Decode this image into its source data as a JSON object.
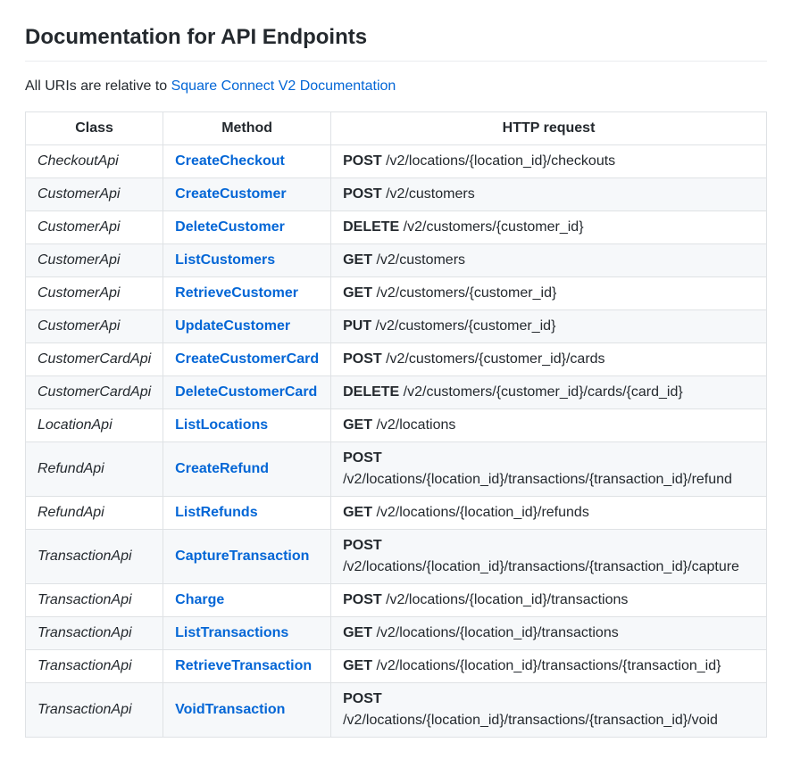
{
  "heading": "Documentation for API Endpoints",
  "intro_prefix": "All URIs are relative to ",
  "intro_link": "Square Connect V2 Documentation",
  "table": {
    "headers": {
      "class": "Class",
      "method": "Method",
      "request": "HTTP request"
    },
    "rows": [
      {
        "class": "CheckoutApi",
        "method": "CreateCheckout",
        "verb": "POST",
        "path": "/v2/locations/{location_id}/checkouts"
      },
      {
        "class": "CustomerApi",
        "method": "CreateCustomer",
        "verb": "POST",
        "path": "/v2/customers"
      },
      {
        "class": "CustomerApi",
        "method": "DeleteCustomer",
        "verb": "DELETE",
        "path": "/v2/customers/{customer_id}"
      },
      {
        "class": "CustomerApi",
        "method": "ListCustomers",
        "verb": "GET",
        "path": "/v2/customers"
      },
      {
        "class": "CustomerApi",
        "method": "RetrieveCustomer",
        "verb": "GET",
        "path": "/v2/customers/{customer_id}"
      },
      {
        "class": "CustomerApi",
        "method": "UpdateCustomer",
        "verb": "PUT",
        "path": "/v2/customers/{customer_id}"
      },
      {
        "class": "CustomerCardApi",
        "method": "CreateCustomerCard",
        "verb": "POST",
        "path": "/v2/customers/{customer_id}/cards"
      },
      {
        "class": "CustomerCardApi",
        "method": "DeleteCustomerCard",
        "verb": "DELETE",
        "path": "/v2/customers/{customer_id}/cards/{card_id}"
      },
      {
        "class": "LocationApi",
        "method": "ListLocations",
        "verb": "GET",
        "path": "/v2/locations"
      },
      {
        "class": "RefundApi",
        "method": "CreateRefund",
        "verb": "POST",
        "path": "/v2/locations/{location_id}/transactions/{transaction_id}/refund"
      },
      {
        "class": "RefundApi",
        "method": "ListRefunds",
        "verb": "GET",
        "path": "/v2/locations/{location_id}/refunds"
      },
      {
        "class": "TransactionApi",
        "method": "CaptureTransaction",
        "verb": "POST",
        "path": "/v2/locations/{location_id}/transactions/{transaction_id}/capture"
      },
      {
        "class": "TransactionApi",
        "method": "Charge",
        "verb": "POST",
        "path": "/v2/locations/{location_id}/transactions"
      },
      {
        "class": "TransactionApi",
        "method": "ListTransactions",
        "verb": "GET",
        "path": "/v2/locations/{location_id}/transactions"
      },
      {
        "class": "TransactionApi",
        "method": "RetrieveTransaction",
        "verb": "GET",
        "path": "/v2/locations/{location_id}/transactions/{transaction_id}"
      },
      {
        "class": "TransactionApi",
        "method": "VoidTransaction",
        "verb": "POST",
        "path": "/v2/locations/{location_id}/transactions/{transaction_id}/void"
      }
    ]
  }
}
